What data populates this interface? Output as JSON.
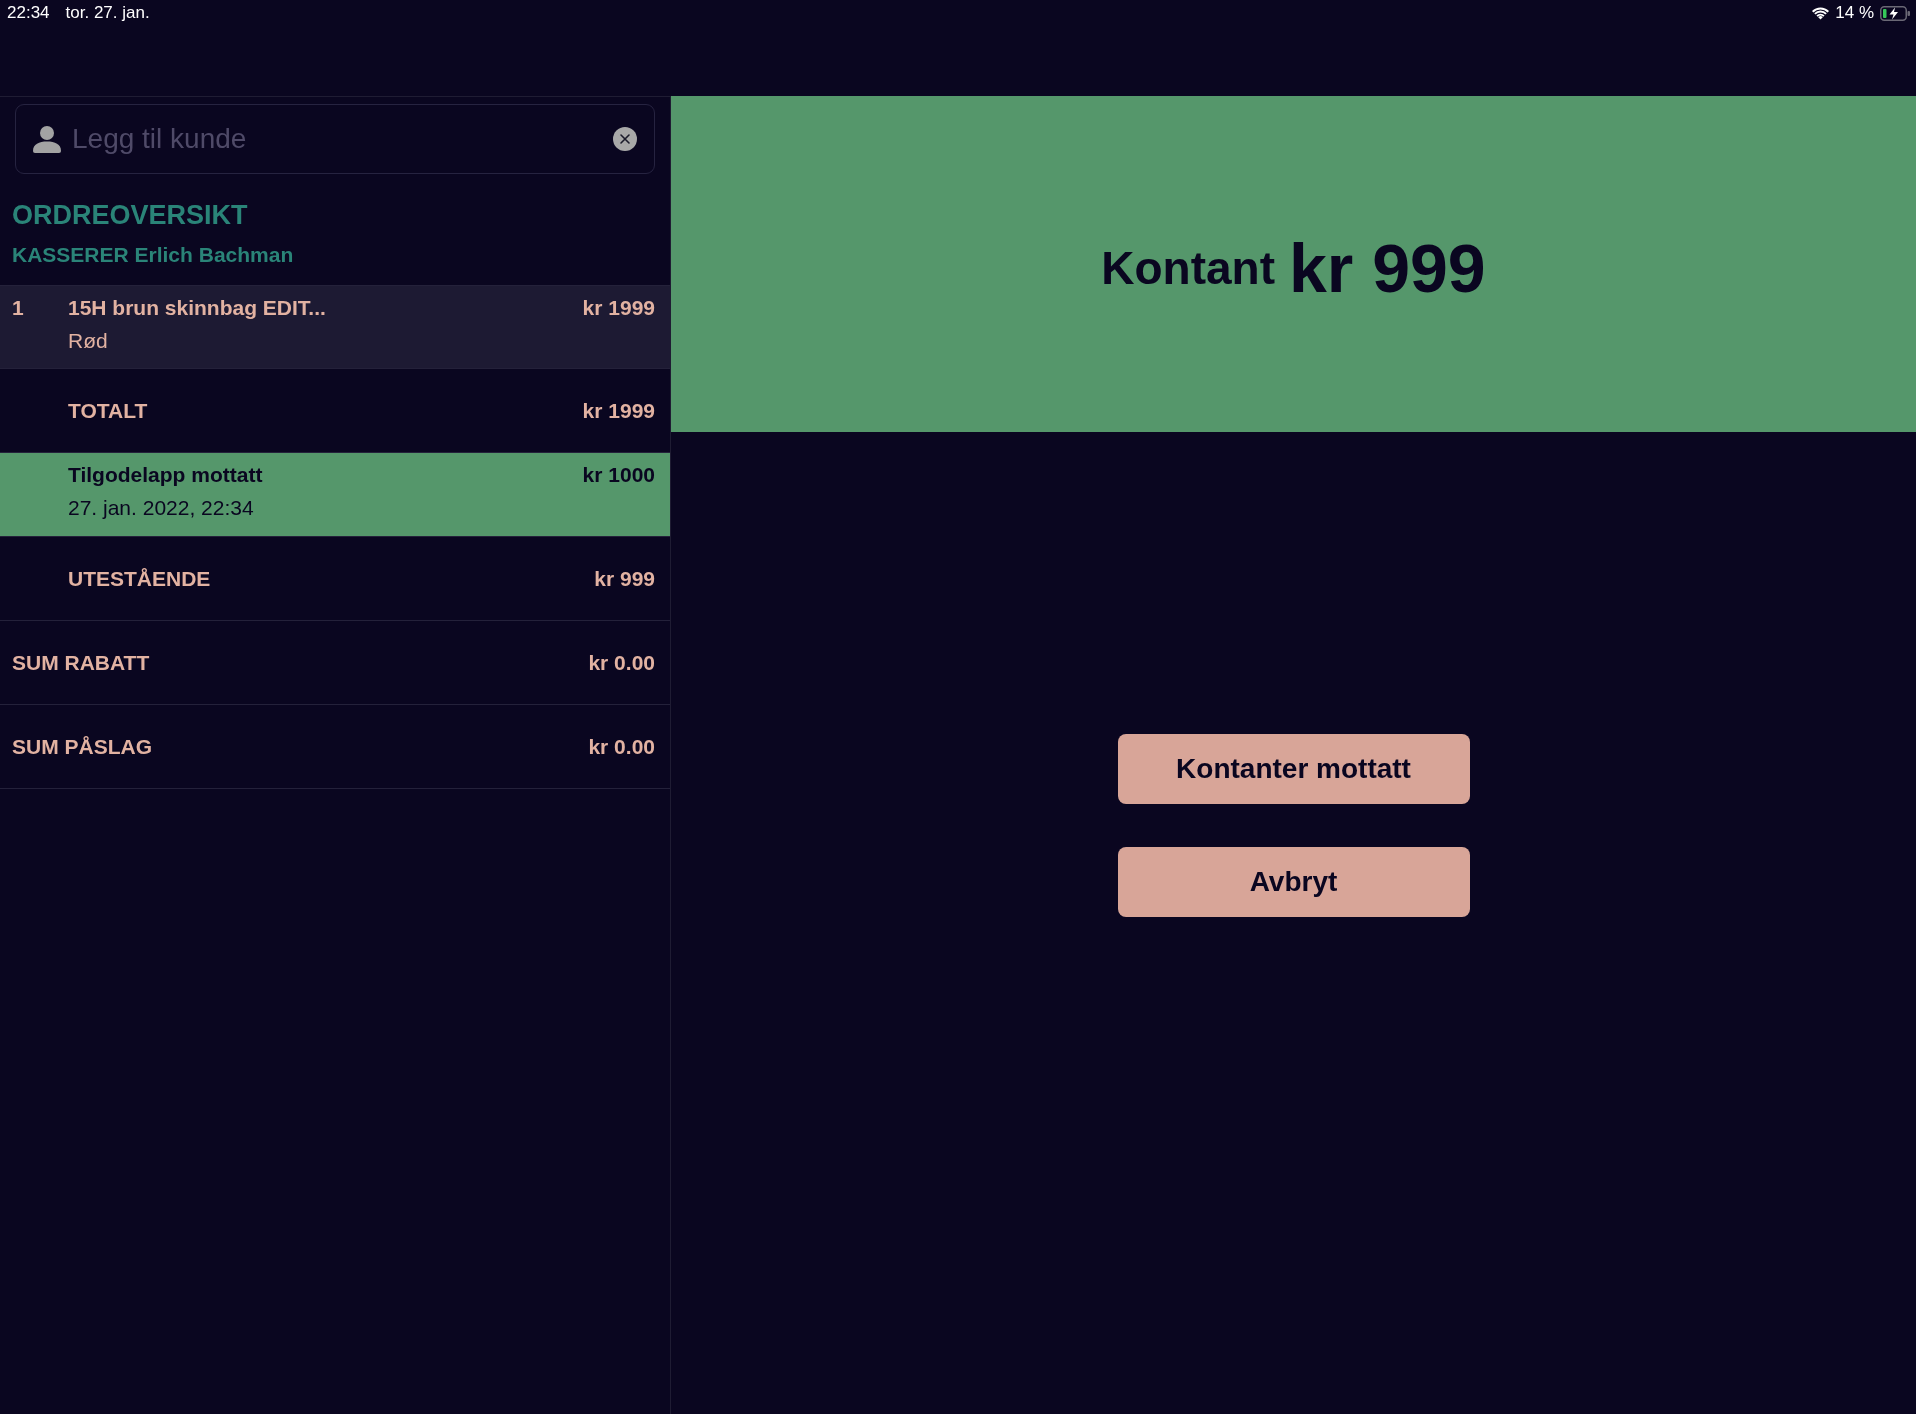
{
  "status_bar": {
    "time": "22:34",
    "date": "tor. 27. jan.",
    "battery_percent": "14 %"
  },
  "customer_field": {
    "placeholder": "Legg til kunde"
  },
  "order_overview": {
    "title": "ORDREOVERSIKT",
    "cashier": "KASSERER Erlich Bachman"
  },
  "rows": [
    {
      "kind": "item",
      "quantity": "1",
      "name": "15H brun skinnbag EDIT...",
      "variant": "Rød",
      "amount": "kr 1999"
    },
    {
      "kind": "total",
      "label": "TOTALT",
      "amount": "kr 1999"
    },
    {
      "kind": "payment",
      "label": "Tilgodelapp mottatt",
      "date": "27. jan. 2022, 22:34",
      "amount": "kr 1000"
    },
    {
      "kind": "total",
      "label": "UTESTÅENDE",
      "amount": "kr 999"
    },
    {
      "kind": "summary",
      "label": "SUM RABATT",
      "amount": "kr 0.00"
    },
    {
      "kind": "summary",
      "label": "SUM PÅSLAG",
      "amount": "kr 0.00"
    }
  ],
  "payment_banner": {
    "method": "Kontant",
    "amount": "kr 999"
  },
  "buttons": [
    {
      "label": "Kontanter mottatt"
    },
    {
      "label": "Avbryt"
    }
  ]
}
